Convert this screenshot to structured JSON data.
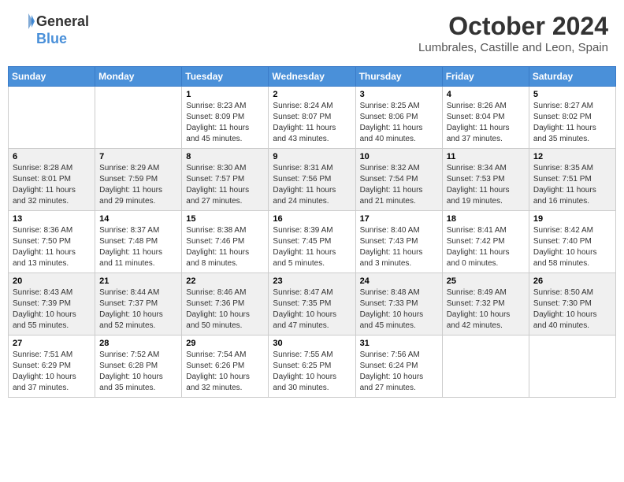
{
  "logo": {
    "general": "General",
    "blue": "Blue"
  },
  "title": "October 2024",
  "location": "Lumbrales, Castille and Leon, Spain",
  "days_of_week": [
    "Sunday",
    "Monday",
    "Tuesday",
    "Wednesday",
    "Thursday",
    "Friday",
    "Saturday"
  ],
  "weeks": [
    [
      {
        "day": "",
        "sunrise": "",
        "sunset": "",
        "daylight": ""
      },
      {
        "day": "",
        "sunrise": "",
        "sunset": "",
        "daylight": ""
      },
      {
        "day": "1",
        "sunrise": "Sunrise: 8:23 AM",
        "sunset": "Sunset: 8:09 PM",
        "daylight": "Daylight: 11 hours and 45 minutes."
      },
      {
        "day": "2",
        "sunrise": "Sunrise: 8:24 AM",
        "sunset": "Sunset: 8:07 PM",
        "daylight": "Daylight: 11 hours and 43 minutes."
      },
      {
        "day": "3",
        "sunrise": "Sunrise: 8:25 AM",
        "sunset": "Sunset: 8:06 PM",
        "daylight": "Daylight: 11 hours and 40 minutes."
      },
      {
        "day": "4",
        "sunrise": "Sunrise: 8:26 AM",
        "sunset": "Sunset: 8:04 PM",
        "daylight": "Daylight: 11 hours and 37 minutes."
      },
      {
        "day": "5",
        "sunrise": "Sunrise: 8:27 AM",
        "sunset": "Sunset: 8:02 PM",
        "daylight": "Daylight: 11 hours and 35 minutes."
      }
    ],
    [
      {
        "day": "6",
        "sunrise": "Sunrise: 8:28 AM",
        "sunset": "Sunset: 8:01 PM",
        "daylight": "Daylight: 11 hours and 32 minutes."
      },
      {
        "day": "7",
        "sunrise": "Sunrise: 8:29 AM",
        "sunset": "Sunset: 7:59 PM",
        "daylight": "Daylight: 11 hours and 29 minutes."
      },
      {
        "day": "8",
        "sunrise": "Sunrise: 8:30 AM",
        "sunset": "Sunset: 7:57 PM",
        "daylight": "Daylight: 11 hours and 27 minutes."
      },
      {
        "day": "9",
        "sunrise": "Sunrise: 8:31 AM",
        "sunset": "Sunset: 7:56 PM",
        "daylight": "Daylight: 11 hours and 24 minutes."
      },
      {
        "day": "10",
        "sunrise": "Sunrise: 8:32 AM",
        "sunset": "Sunset: 7:54 PM",
        "daylight": "Daylight: 11 hours and 21 minutes."
      },
      {
        "day": "11",
        "sunrise": "Sunrise: 8:34 AM",
        "sunset": "Sunset: 7:53 PM",
        "daylight": "Daylight: 11 hours and 19 minutes."
      },
      {
        "day": "12",
        "sunrise": "Sunrise: 8:35 AM",
        "sunset": "Sunset: 7:51 PM",
        "daylight": "Daylight: 11 hours and 16 minutes."
      }
    ],
    [
      {
        "day": "13",
        "sunrise": "Sunrise: 8:36 AM",
        "sunset": "Sunset: 7:50 PM",
        "daylight": "Daylight: 11 hours and 13 minutes."
      },
      {
        "day": "14",
        "sunrise": "Sunrise: 8:37 AM",
        "sunset": "Sunset: 7:48 PM",
        "daylight": "Daylight: 11 hours and 11 minutes."
      },
      {
        "day": "15",
        "sunrise": "Sunrise: 8:38 AM",
        "sunset": "Sunset: 7:46 PM",
        "daylight": "Daylight: 11 hours and 8 minutes."
      },
      {
        "day": "16",
        "sunrise": "Sunrise: 8:39 AM",
        "sunset": "Sunset: 7:45 PM",
        "daylight": "Daylight: 11 hours and 5 minutes."
      },
      {
        "day": "17",
        "sunrise": "Sunrise: 8:40 AM",
        "sunset": "Sunset: 7:43 PM",
        "daylight": "Daylight: 11 hours and 3 minutes."
      },
      {
        "day": "18",
        "sunrise": "Sunrise: 8:41 AM",
        "sunset": "Sunset: 7:42 PM",
        "daylight": "Daylight: 11 hours and 0 minutes."
      },
      {
        "day": "19",
        "sunrise": "Sunrise: 8:42 AM",
        "sunset": "Sunset: 7:40 PM",
        "daylight": "Daylight: 10 hours and 58 minutes."
      }
    ],
    [
      {
        "day": "20",
        "sunrise": "Sunrise: 8:43 AM",
        "sunset": "Sunset: 7:39 PM",
        "daylight": "Daylight: 10 hours and 55 minutes."
      },
      {
        "day": "21",
        "sunrise": "Sunrise: 8:44 AM",
        "sunset": "Sunset: 7:37 PM",
        "daylight": "Daylight: 10 hours and 52 minutes."
      },
      {
        "day": "22",
        "sunrise": "Sunrise: 8:46 AM",
        "sunset": "Sunset: 7:36 PM",
        "daylight": "Daylight: 10 hours and 50 minutes."
      },
      {
        "day": "23",
        "sunrise": "Sunrise: 8:47 AM",
        "sunset": "Sunset: 7:35 PM",
        "daylight": "Daylight: 10 hours and 47 minutes."
      },
      {
        "day": "24",
        "sunrise": "Sunrise: 8:48 AM",
        "sunset": "Sunset: 7:33 PM",
        "daylight": "Daylight: 10 hours and 45 minutes."
      },
      {
        "day": "25",
        "sunrise": "Sunrise: 8:49 AM",
        "sunset": "Sunset: 7:32 PM",
        "daylight": "Daylight: 10 hours and 42 minutes."
      },
      {
        "day": "26",
        "sunrise": "Sunrise: 8:50 AM",
        "sunset": "Sunset: 7:30 PM",
        "daylight": "Daylight: 10 hours and 40 minutes."
      }
    ],
    [
      {
        "day": "27",
        "sunrise": "Sunrise: 7:51 AM",
        "sunset": "Sunset: 6:29 PM",
        "daylight": "Daylight: 10 hours and 37 minutes."
      },
      {
        "day": "28",
        "sunrise": "Sunrise: 7:52 AM",
        "sunset": "Sunset: 6:28 PM",
        "daylight": "Daylight: 10 hours and 35 minutes."
      },
      {
        "day": "29",
        "sunrise": "Sunrise: 7:54 AM",
        "sunset": "Sunset: 6:26 PM",
        "daylight": "Daylight: 10 hours and 32 minutes."
      },
      {
        "day": "30",
        "sunrise": "Sunrise: 7:55 AM",
        "sunset": "Sunset: 6:25 PM",
        "daylight": "Daylight: 10 hours and 30 minutes."
      },
      {
        "day": "31",
        "sunrise": "Sunrise: 7:56 AM",
        "sunset": "Sunset: 6:24 PM",
        "daylight": "Daylight: 10 hours and 27 minutes."
      },
      {
        "day": "",
        "sunrise": "",
        "sunset": "",
        "daylight": ""
      },
      {
        "day": "",
        "sunrise": "",
        "sunset": "",
        "daylight": ""
      }
    ]
  ]
}
